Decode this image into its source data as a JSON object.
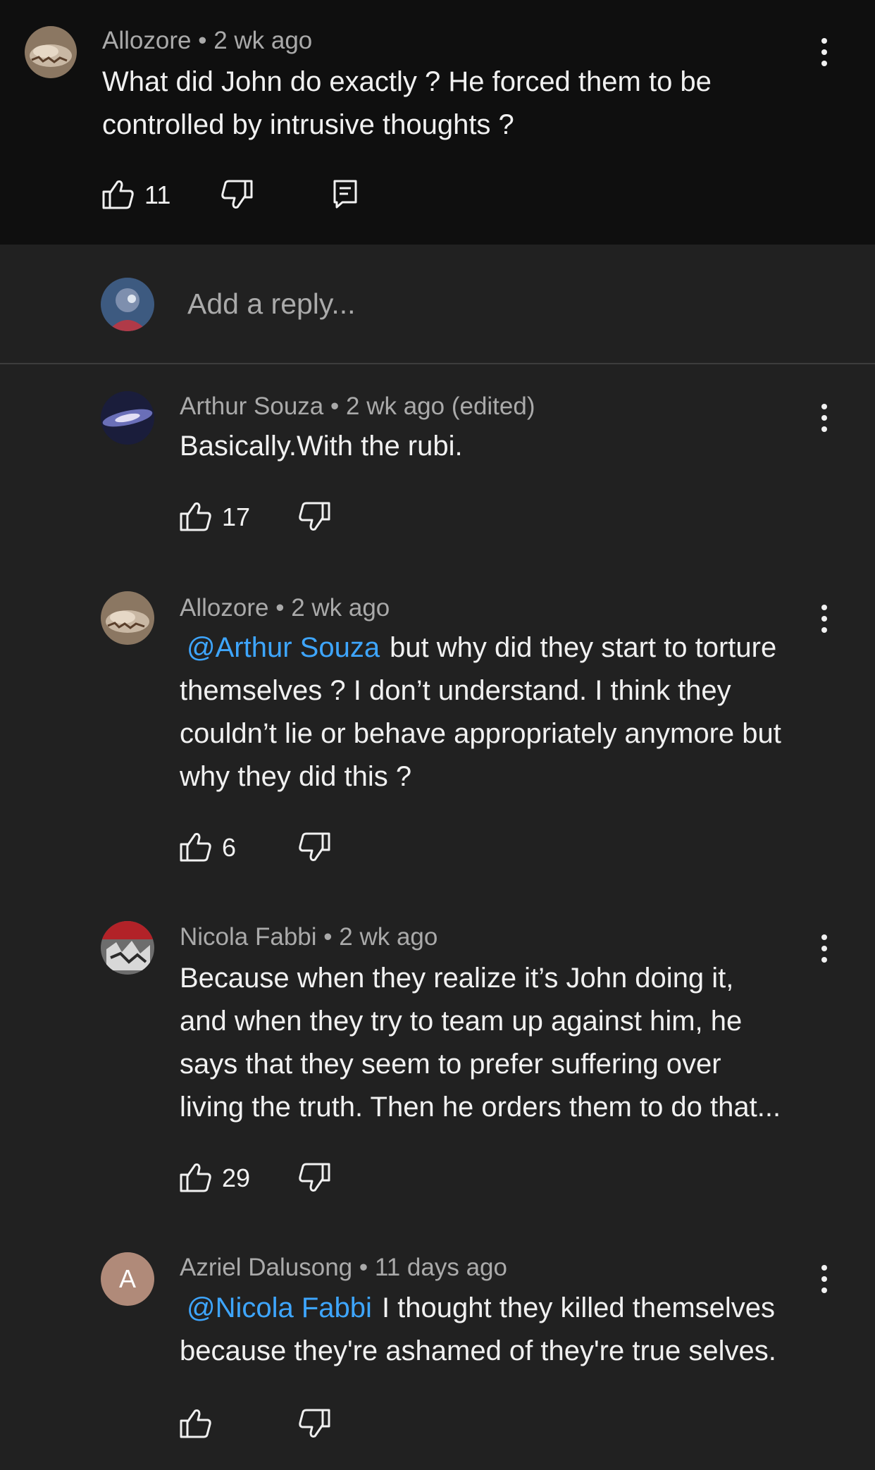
{
  "comment": {
    "author": "Allozore",
    "time": "2 wk ago",
    "text_line1": "What did John do exactly ? He forced them to be",
    "text_line2": "controlled by intrusive thoughts ?",
    "likes": "11"
  },
  "reply_input": {
    "placeholder": "Add a reply..."
  },
  "replies": [
    {
      "author": "Arthur Souza",
      "time": "2 wk ago (edited)",
      "lines": [
        "Basically.With the rubi."
      ],
      "likes": "17"
    },
    {
      "author": "Allozore",
      "time": "2 wk ago",
      "mention": "@Arthur Souza",
      "lines": [
        "but why did they start to torture",
        "themselves ? I don’t understand. I think they",
        "couldn’t lie or behave appropriately anymore but",
        "why they did this ?"
      ],
      "likes": "6"
    },
    {
      "author": "Nicola Fabbi",
      "time": "2 wk ago",
      "lines": [
        "Because when they realize it’s John doing it,",
        "and when they try to team up against him, he",
        "says that they seem to prefer suffering over",
        "living the truth. Then he orders them to do that..."
      ],
      "likes": "29"
    },
    {
      "author": "Azriel Dalusong",
      "time": "11 days ago",
      "avatar_letter": "A",
      "mention": "@Nicola Fabbi",
      "lines": [
        "I thought they killed themselves",
        "because they're ashamed of they're true selves."
      ],
      "likes": ""
    }
  ],
  "separator": "•",
  "colors": {
    "background": "#212121",
    "top_background": "#0f0f0f",
    "mention": "#3ea6ff",
    "meta_text": "#aaaaaa",
    "letter_avatar": "#b08a79"
  },
  "icons": [
    "like-icon",
    "dislike-icon",
    "reply-icon",
    "more-vert-icon"
  ]
}
